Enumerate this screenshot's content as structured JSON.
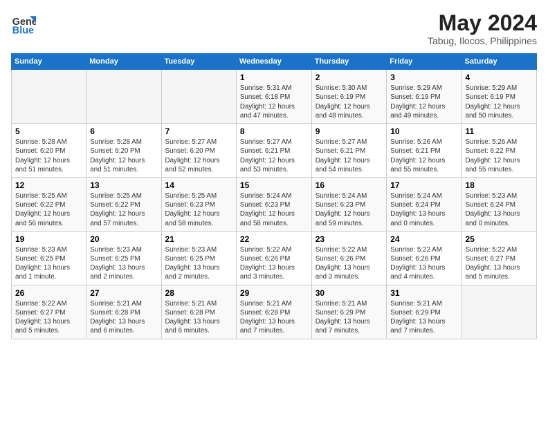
{
  "header": {
    "logo_line1": "General",
    "logo_line2": "Blue",
    "month_title": "May 2024",
    "location": "Tabug, Ilocos, Philippines"
  },
  "days_of_week": [
    "Sunday",
    "Monday",
    "Tuesday",
    "Wednesday",
    "Thursday",
    "Friday",
    "Saturday"
  ],
  "weeks": [
    [
      {
        "day": "",
        "info": ""
      },
      {
        "day": "",
        "info": ""
      },
      {
        "day": "",
        "info": ""
      },
      {
        "day": "1",
        "info": "Sunrise: 5:31 AM\nSunset: 6:18 PM\nDaylight: 12 hours\nand 47 minutes."
      },
      {
        "day": "2",
        "info": "Sunrise: 5:30 AM\nSunset: 6:19 PM\nDaylight: 12 hours\nand 48 minutes."
      },
      {
        "day": "3",
        "info": "Sunrise: 5:29 AM\nSunset: 6:19 PM\nDaylight: 12 hours\nand 49 minutes."
      },
      {
        "day": "4",
        "info": "Sunrise: 5:29 AM\nSunset: 6:19 PM\nDaylight: 12 hours\nand 50 minutes."
      }
    ],
    [
      {
        "day": "5",
        "info": "Sunrise: 5:28 AM\nSunset: 6:20 PM\nDaylight: 12 hours\nand 51 minutes."
      },
      {
        "day": "6",
        "info": "Sunrise: 5:28 AM\nSunset: 6:20 PM\nDaylight: 12 hours\nand 51 minutes."
      },
      {
        "day": "7",
        "info": "Sunrise: 5:27 AM\nSunset: 6:20 PM\nDaylight: 12 hours\nand 52 minutes."
      },
      {
        "day": "8",
        "info": "Sunrise: 5:27 AM\nSunset: 6:21 PM\nDaylight: 12 hours\nand 53 minutes."
      },
      {
        "day": "9",
        "info": "Sunrise: 5:27 AM\nSunset: 6:21 PM\nDaylight: 12 hours\nand 54 minutes."
      },
      {
        "day": "10",
        "info": "Sunrise: 5:26 AM\nSunset: 6:21 PM\nDaylight: 12 hours\nand 55 minutes."
      },
      {
        "day": "11",
        "info": "Sunrise: 5:26 AM\nSunset: 6:22 PM\nDaylight: 12 hours\nand 55 minutes."
      }
    ],
    [
      {
        "day": "12",
        "info": "Sunrise: 5:25 AM\nSunset: 6:22 PM\nDaylight: 12 hours\nand 56 minutes."
      },
      {
        "day": "13",
        "info": "Sunrise: 5:25 AM\nSunset: 6:22 PM\nDaylight: 12 hours\nand 57 minutes."
      },
      {
        "day": "14",
        "info": "Sunrise: 5:25 AM\nSunset: 6:23 PM\nDaylight: 12 hours\nand 58 minutes."
      },
      {
        "day": "15",
        "info": "Sunrise: 5:24 AM\nSunset: 6:23 PM\nDaylight: 12 hours\nand 58 minutes."
      },
      {
        "day": "16",
        "info": "Sunrise: 5:24 AM\nSunset: 6:23 PM\nDaylight: 12 hours\nand 59 minutes."
      },
      {
        "day": "17",
        "info": "Sunrise: 5:24 AM\nSunset: 6:24 PM\nDaylight: 13 hours\nand 0 minutes."
      },
      {
        "day": "18",
        "info": "Sunrise: 5:23 AM\nSunset: 6:24 PM\nDaylight: 13 hours\nand 0 minutes."
      }
    ],
    [
      {
        "day": "19",
        "info": "Sunrise: 5:23 AM\nSunset: 6:25 PM\nDaylight: 13 hours\nand 1 minute."
      },
      {
        "day": "20",
        "info": "Sunrise: 5:23 AM\nSunset: 6:25 PM\nDaylight: 13 hours\nand 2 minutes."
      },
      {
        "day": "21",
        "info": "Sunrise: 5:23 AM\nSunset: 6:25 PM\nDaylight: 13 hours\nand 2 minutes."
      },
      {
        "day": "22",
        "info": "Sunrise: 5:22 AM\nSunset: 6:26 PM\nDaylight: 13 hours\nand 3 minutes."
      },
      {
        "day": "23",
        "info": "Sunrise: 5:22 AM\nSunset: 6:26 PM\nDaylight: 13 hours\nand 3 minutes."
      },
      {
        "day": "24",
        "info": "Sunrise: 5:22 AM\nSunset: 6:26 PM\nDaylight: 13 hours\nand 4 minutes."
      },
      {
        "day": "25",
        "info": "Sunrise: 5:22 AM\nSunset: 6:27 PM\nDaylight: 13 hours\nand 5 minutes."
      }
    ],
    [
      {
        "day": "26",
        "info": "Sunrise: 5:22 AM\nSunset: 6:27 PM\nDaylight: 13 hours\nand 5 minutes."
      },
      {
        "day": "27",
        "info": "Sunrise: 5:21 AM\nSunset: 6:28 PM\nDaylight: 13 hours\nand 6 minutes."
      },
      {
        "day": "28",
        "info": "Sunrise: 5:21 AM\nSunset: 6:28 PM\nDaylight: 13 hours\nand 6 minutes."
      },
      {
        "day": "29",
        "info": "Sunrise: 5:21 AM\nSunset: 6:28 PM\nDaylight: 13 hours\nand 7 minutes."
      },
      {
        "day": "30",
        "info": "Sunrise: 5:21 AM\nSunset: 6:29 PM\nDaylight: 13 hours\nand 7 minutes."
      },
      {
        "day": "31",
        "info": "Sunrise: 5:21 AM\nSunset: 6:29 PM\nDaylight: 13 hours\nand 7 minutes."
      },
      {
        "day": "",
        "info": ""
      }
    ]
  ]
}
